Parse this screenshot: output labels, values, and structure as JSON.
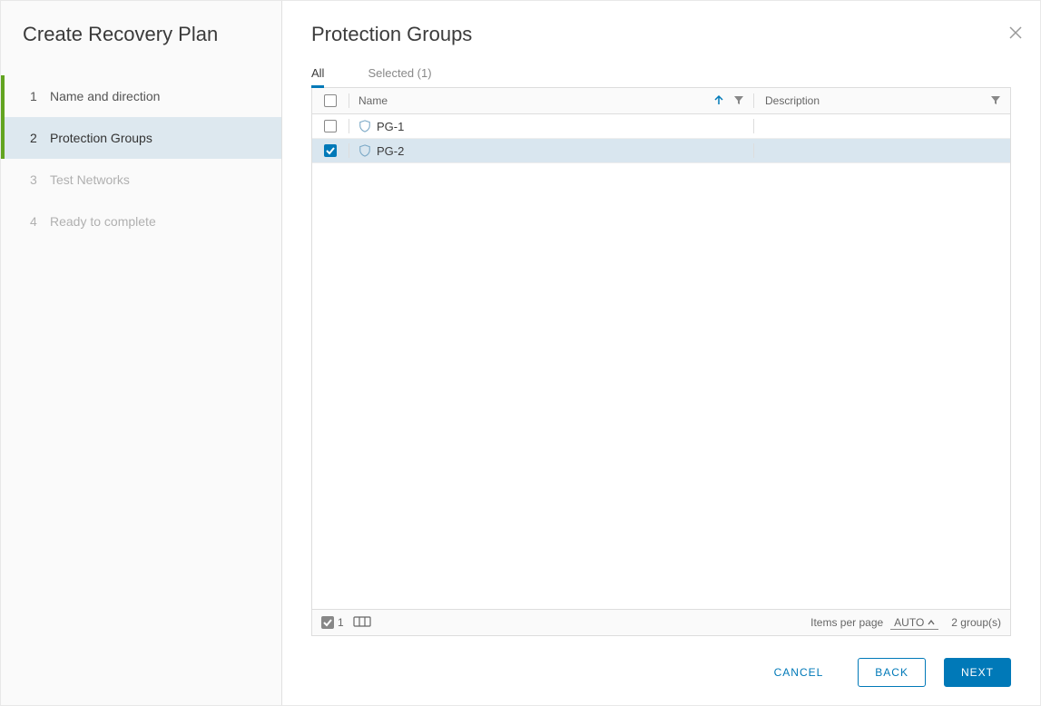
{
  "sidebar": {
    "title": "Create Recovery Plan",
    "steps": [
      {
        "index": "1",
        "label": "Name and direction"
      },
      {
        "index": "2",
        "label": "Protection Groups"
      },
      {
        "index": "3",
        "label": "Test Networks"
      },
      {
        "index": "4",
        "label": "Ready to complete"
      }
    ]
  },
  "main": {
    "title": "Protection Groups",
    "tabs": {
      "all": "All",
      "selected": "Selected (1)"
    },
    "table": {
      "headers": {
        "name": "Name",
        "description": "Description"
      },
      "rows": [
        {
          "name": "PG-1",
          "description": "",
          "checked": false
        },
        {
          "name": "PG-2",
          "description": "",
          "checked": true
        }
      ],
      "footer": {
        "selected_count": "1",
        "items_per_page_label": "Items per page",
        "items_per_page_value": "AUTO",
        "total_label": "2 group(s)"
      }
    }
  },
  "actions": {
    "cancel": "CANCEL",
    "back": "BACK",
    "next": "NEXT"
  }
}
